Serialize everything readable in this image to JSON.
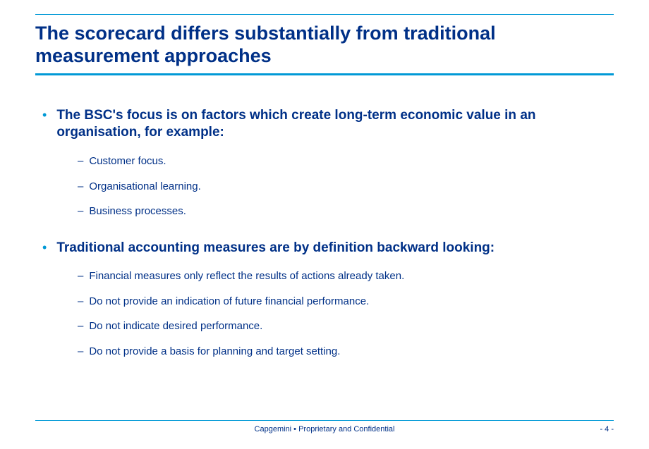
{
  "title": "The scorecard differs substantially from traditional measurement approaches",
  "sections": [
    {
      "heading": "The BSC's focus is on factors which create long-term economic value in an organisation, for example:",
      "items": [
        "Customer focus.",
        "Organisational learning.",
        "Business processes."
      ]
    },
    {
      "heading": "Traditional accounting measures are by definition backward looking:",
      "items": [
        "Financial measures only reflect the results of actions already taken.",
        "Do not provide an indication of future financial performance.",
        "Do not indicate desired performance.",
        "Do not provide a basis for planning and target setting."
      ]
    }
  ],
  "footer": {
    "center": "Capgemini  •  Proprietary and Confidential",
    "page": "- 4 -"
  }
}
